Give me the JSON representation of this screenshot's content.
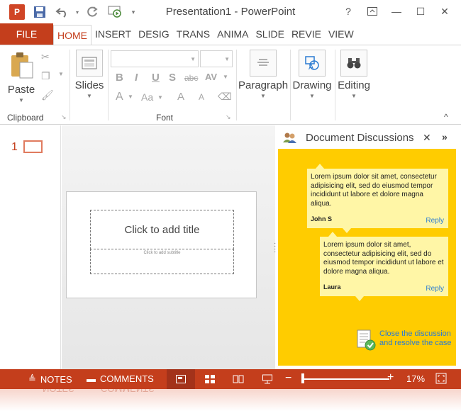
{
  "window": {
    "title": "Presentation1 - PowerPoint",
    "controls": {
      "help": "?",
      "minimize": "—",
      "maximize": "☐",
      "close": "✕"
    }
  },
  "qat": {
    "logo": "P",
    "save_icon": "save-icon",
    "undo_icon": "undo-icon",
    "redo_icon": "redo-icon",
    "present_icon": "present-icon",
    "customize": "▾"
  },
  "tabs": {
    "file": "FILE",
    "items": [
      "HOME",
      "INSERT",
      "DESIG",
      "TRANS",
      "ANIMA",
      "SLIDE",
      "REVIE",
      "VIEW"
    ],
    "active": "HOME"
  },
  "ribbon": {
    "clipboard": {
      "paste": "Paste",
      "label": "Clipboard"
    },
    "slides": {
      "label": "Slides"
    },
    "font": {
      "label": "Font",
      "bold": "B",
      "italic": "I",
      "underline": "U",
      "shadow": "S",
      "strike": "abc",
      "spacing": "AV",
      "fontcolor": "A",
      "changecase": "Aa",
      "grow": "A",
      "shrink": "A"
    },
    "paragraph": {
      "label": "Paragraph"
    },
    "drawing": {
      "label": "Drawing"
    },
    "editing": {
      "label": "Editing"
    },
    "collapse": "^"
  },
  "thumbnails": {
    "slide_number": "1"
  },
  "slide": {
    "title_placeholder": "Click to add title",
    "subtitle_placeholder": "Click to add subtitle"
  },
  "discussion": {
    "title": "Document Discussions",
    "close": "✕",
    "more": "»",
    "comments": [
      {
        "text": "Lorem ipsum dolor sit amet, consectetur adipisicing elit, sed do eiusmod tempor incididunt ut labore et dolore magna aliqua.",
        "author": "John S",
        "reply": "Reply"
      },
      {
        "text": "Lorem ipsum dolor sit amet, consectetur adipisicing elit, sed do eiusmod tempor incididunt ut labore et dolore magna aliqua.",
        "author": "Laura",
        "reply": "Reply"
      }
    ],
    "resolve_line1": "Close the discussion",
    "resolve_line2": "and resolve the case"
  },
  "statusbar": {
    "notes": "NOTES",
    "comments": "COMMENTS",
    "zoom_minus": "−",
    "zoom_plus": "+",
    "zoom": "17%",
    "zoom_fraction": 0.02
  },
  "colors": {
    "accent": "#c43e1c",
    "discussion_bg": "#ffcc00",
    "bubble": "#fff6a6",
    "link": "#2b7bd1"
  }
}
